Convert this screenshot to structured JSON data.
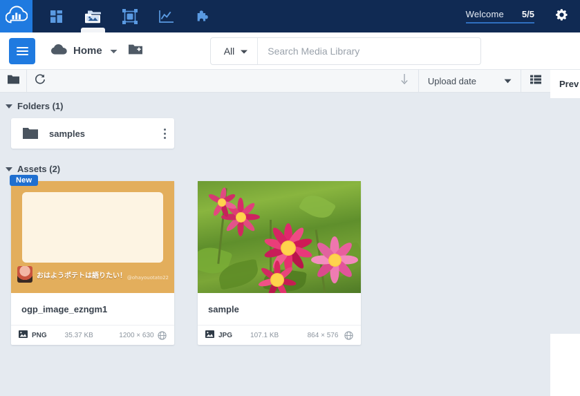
{
  "topnav": {
    "logo_icon": "cloud-bars-logo-icon",
    "items": [
      {
        "name": "dashboard",
        "icon": "dashboard-grid-icon",
        "active": false
      },
      {
        "name": "media-library",
        "icon": "media-library-icon",
        "active": true
      },
      {
        "name": "transformations",
        "icon": "transform-frame-icon",
        "active": false
      },
      {
        "name": "analytics",
        "icon": "analytics-chart-icon",
        "active": false
      },
      {
        "name": "addons",
        "icon": "puzzle-piece-icon",
        "active": false
      }
    ],
    "welcome_label": "Welcome",
    "welcome_count": "5/5",
    "settings_icon": "gear-icon"
  },
  "breadcrumb": {
    "menu_icon": "hamburger-menu-icon",
    "cloud_icon": "cloud-icon",
    "home_label": "Home",
    "caret_icon": "chevron-down-icon",
    "new_folder_icon": "new-folder-icon"
  },
  "search": {
    "scope_label": "All",
    "scope_caret_icon": "chevron-down-icon",
    "placeholder": "Search Media Library",
    "value": ""
  },
  "toolbar": {
    "folder_view_icon": "folder-icon",
    "refresh_icon": "refresh-icon",
    "sort_direction_icon": "arrow-down-icon",
    "sort_by_label": "Upload date",
    "sort_caret_icon": "chevron-down-icon",
    "view_mode_icon": "list-view-icon"
  },
  "folders": {
    "section_label": "Folders (1)",
    "items": [
      {
        "name": "samples",
        "icon": "folder-icon",
        "menu_icon": "kebab-menu-icon"
      }
    ]
  },
  "assets": {
    "section_label": "Assets (2)",
    "items": [
      {
        "badge": "New",
        "name": "ogp_image_ezngm1",
        "format": "PNG",
        "size": "35.37 KB",
        "dimensions": "1200 × 630",
        "access_icon": "globe-icon",
        "thumb_kind": "ogp-card",
        "thumb_text": "おはようポテトは語りたい！",
        "thumb_handle": "@ohayouotato22",
        "thumb_bg": "#e3ae5c",
        "thumb_panel": "#fdf4e3"
      },
      {
        "badge": "",
        "name": "sample",
        "format": "JPG",
        "size": "107.1 KB",
        "dimensions": "864 × 576",
        "access_icon": "globe-icon",
        "thumb_kind": "photo-flowers",
        "thumb_text": "",
        "thumb_handle": "",
        "thumb_bg": "#6d9b33",
        "thumb_panel": "#e0337a"
      }
    ]
  },
  "preview_panel": {
    "title": "Prev"
  },
  "colors": {
    "topbar": "#102a53",
    "brand_blue": "#1f7ae0",
    "page_bg": "#e5eaf0",
    "card_bg": "#ffffff",
    "badge_blue": "#1f6fd0",
    "text_dark": "#3d4651",
    "text_muted": "#8b949e"
  }
}
